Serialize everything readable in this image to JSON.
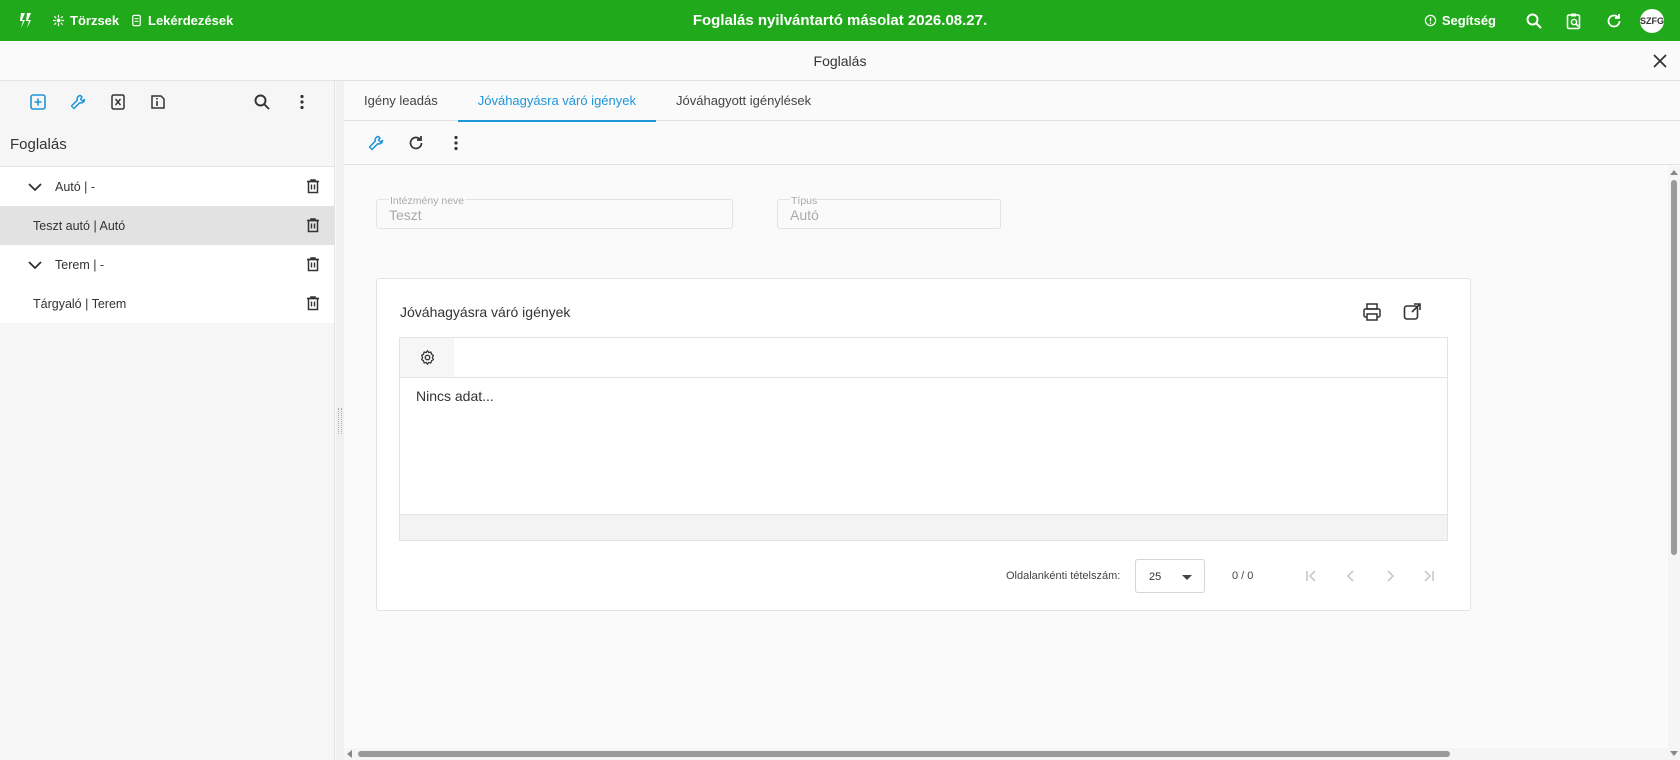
{
  "topbar": {
    "app_title": "Foglalás nyilvántartó másolat 2026.08.27.",
    "nav": [
      {
        "label": "Törzsek",
        "icon": "hub-icon"
      },
      {
        "label": "Lekérdezések",
        "icon": "query-icon"
      }
    ],
    "help_label": "Segítség",
    "avatar_initials": "SZFG",
    "brand_color": "#20a91a"
  },
  "subheader": {
    "title": "Foglalás"
  },
  "left_panel": {
    "title": "Foglalás",
    "tree": [
      {
        "label": "Autó | -",
        "type": "group",
        "expanded": true
      },
      {
        "label": "Teszt autó | Autó",
        "type": "child",
        "selected": true
      },
      {
        "label": "Terem | -",
        "type": "group",
        "expanded": true
      },
      {
        "label": "Tárgyaló | Terem",
        "type": "child",
        "selected": false
      }
    ]
  },
  "main": {
    "tabs": [
      {
        "label": "Igény leadás",
        "active": false
      },
      {
        "label": "Jóváhagyásra váró igények",
        "active": true
      },
      {
        "label": "Jóváhagyott igénylések",
        "active": false
      }
    ],
    "fields": {
      "institution": {
        "label": "Intézmény neve",
        "value": "Teszt"
      },
      "type": {
        "label": "Típus",
        "value": "Autó"
      }
    },
    "card": {
      "title": "Jóváhagyásra váró igények",
      "no_data": "Nincs adat...",
      "pager": {
        "page_size_label": "Oldalankénti tételszám:",
        "page_size": "25",
        "count": "0 / 0"
      }
    },
    "accent_color": "#1e96d8"
  }
}
